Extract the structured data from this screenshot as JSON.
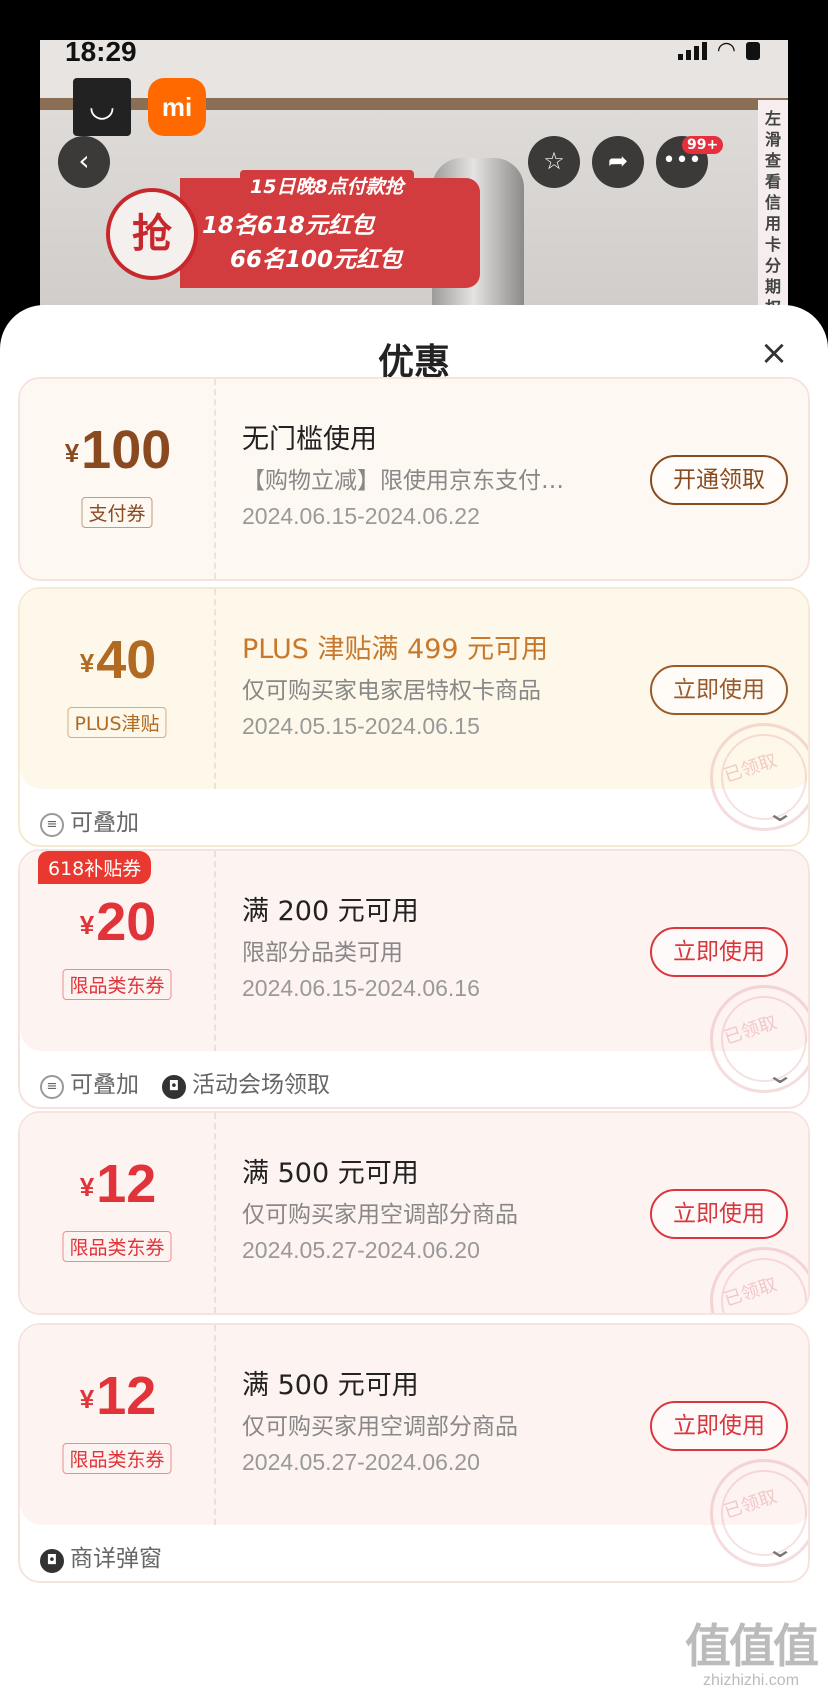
{
  "status_bar": {
    "time": "18:29"
  },
  "background": {
    "promo_big_char": "抢",
    "promo_line1": "15日晚8点付款抢",
    "promo_line2": "18名618元红包",
    "promo_line3": "66名100元红包",
    "side_text": "左滑查看信用卡分期权",
    "more_badge": "99+",
    "brand_b": "mi"
  },
  "sheet": {
    "title": "优惠",
    "close": "×"
  },
  "coupons": [
    {
      "yen": "¥",
      "amount": "100",
      "tag": "支付券",
      "title": "无门槛使用",
      "desc": "【购物立减】限使用京东支付…",
      "date": "2024.06.15-2024.06.22",
      "button": "开通领取",
      "colors": {
        "bg": "#fef8f2",
        "amount": "#8a4a20",
        "title": "#222222",
        "button": "#8a4a20"
      }
    },
    {
      "yen": "¥",
      "amount": "40",
      "tag": "PLUS津贴",
      "title": "PLUS 津贴满 499 元可用",
      "desc": "仅可购买家电家居特权卡商品",
      "date": "2024.05.15-2024.06.15",
      "button": "立即使用",
      "stamp": "已领取",
      "footer": [
        {
          "icon": "stack-icon",
          "label": "可叠加"
        }
      ],
      "colors": {
        "bg": "#fef8ea",
        "amount": "#b06a22",
        "title": "#c8782a",
        "button": "#9a5a2a"
      }
    },
    {
      "corner_badge": "618补贴券",
      "yen": "¥",
      "amount": "20",
      "tag": "限品类东券",
      "title": "满 200 元可用",
      "desc": "限部分品类可用",
      "date": "2024.06.15-2024.06.16",
      "button": "立即使用",
      "stamp": "已领取",
      "footer": [
        {
          "icon": "stack-icon",
          "label": "可叠加"
        },
        {
          "icon": "venue-icon",
          "label": "活动会场领取"
        }
      ],
      "colors": {
        "bg": "#fdf3f1",
        "amount": "#e0343a",
        "title": "#222222",
        "button": "#d9363e"
      }
    },
    {
      "yen": "¥",
      "amount": "12",
      "tag": "限品类东券",
      "title": "满 500 元可用",
      "desc": "仅可购买家用空调部分商品",
      "date": "2024.05.27-2024.06.20",
      "button": "立即使用",
      "stamp": "已领取",
      "colors": {
        "bg": "#fdf3f1",
        "amount": "#e0343a",
        "title": "#222222",
        "button": "#d9363e"
      }
    },
    {
      "yen": "¥",
      "amount": "12",
      "tag": "限品类东券",
      "title": "满 500 元可用",
      "desc": "仅可购买家用空调部分商品",
      "date": "2024.05.27-2024.06.20",
      "button": "立即使用",
      "stamp": "已领取",
      "footer": [
        {
          "icon": "venue-icon",
          "label": "商详弹窗"
        }
      ],
      "colors": {
        "bg": "#fdf3f1",
        "amount": "#e0343a",
        "title": "#222222",
        "button": "#d9363e"
      }
    }
  ],
  "watermark": {
    "logo": "值值值",
    "url": "zhizhizhi.com"
  }
}
